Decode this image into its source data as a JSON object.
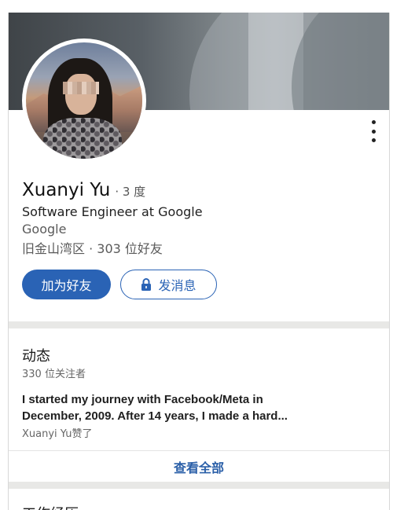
{
  "profile": {
    "name": "Xuanyi Yu",
    "degree": "· 3 度",
    "headline": "Software Engineer at Google",
    "company": "Google",
    "location": "旧金山湾区 · 303 位好友"
  },
  "actions": {
    "add_friend": "加为好友",
    "message": "发消息"
  },
  "activity": {
    "title": "动态",
    "followers": "330 位关注者",
    "post_line1": "I started my journey with Facebook/Meta in",
    "post_line2": "December, 2009. After 14 years, I made a hard...",
    "post_reaction": "Xuanyi Yu赞了",
    "see_all": "查看全部"
  },
  "next_section": {
    "title": "工作经历"
  },
  "colors": {
    "accent": "#2a63b5",
    "link": "#2a5fa8",
    "divider": "#e8e8e6"
  },
  "icons": {
    "more": "kebab-menu-icon",
    "message": "lock-icon"
  }
}
